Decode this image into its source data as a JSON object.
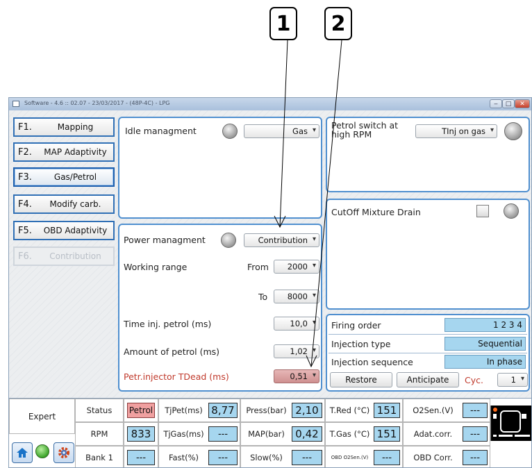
{
  "callouts": [
    "1",
    "2"
  ],
  "window": {
    "title": "Software - 4.6 :: 02.07 - 23/03/2017 - (48P-4C) - LPG",
    "controls": {
      "minimize": "‒",
      "maximize": "□",
      "close": "✕"
    }
  },
  "sidebar": [
    {
      "key": "F1.",
      "label": "Mapping",
      "state": "normal"
    },
    {
      "key": "F2.",
      "label": "MAP Adaptivity",
      "state": "normal"
    },
    {
      "key": "F3.",
      "label": "Gas/Petrol",
      "state": "active"
    },
    {
      "key": "F4.",
      "label": "Modify carb.",
      "state": "normal"
    },
    {
      "key": "F5.",
      "label": "OBD Adaptivity",
      "state": "normal"
    },
    {
      "key": "F6.",
      "label": "Contribution",
      "state": "disabled"
    }
  ],
  "idle": {
    "label": "Idle managment",
    "value": "Gas"
  },
  "power": {
    "label": "Power managment",
    "value": "Contribution",
    "working_range_label": "Working range",
    "from_label": "From",
    "from_value": "2000",
    "to_label": "To",
    "to_value": "8000",
    "time_inj_label": "Time inj. petrol (ms)",
    "time_inj_value": "10,0",
    "amount_label": "Amount of petrol (ms)",
    "amount_value": "1,02",
    "tdead_label": "Petr.injector TDead (ms)",
    "tdead_value": "0,51"
  },
  "petrol_switch": {
    "label": "Petrol switch at high RPM",
    "value": "TInj on gas"
  },
  "cutoff": {
    "label": "CutOff Mixture Drain"
  },
  "injection": {
    "firing_order_label": "Firing order",
    "firing_order_value": "1 2 3 4",
    "injection_type_label": "Injection type",
    "injection_type_value": "Sequential",
    "injection_sequence_label": "Injection sequence",
    "injection_sequence_value": "In phase",
    "restore_label": "Restore",
    "anticipate_label": "Anticipate",
    "cyc_label": "Cyc.",
    "cyc_value": "1"
  },
  "status_bar": {
    "mode": "Expert",
    "row1": {
      "status_label": "Status",
      "status_value": "Petrol",
      "tjpet_label": "TjPet(ms)",
      "tjpet_value": "8,77",
      "press_label": "Press(bar)",
      "press_value": "2,10",
      "tred_label": "T.Red (°C)",
      "tred_value": "151",
      "o2_label": "O2Sen.(V)",
      "o2_value": "---"
    },
    "row2": {
      "rpm_label": "RPM",
      "rpm_value": "833",
      "tjgas_label": "TjGas(ms)",
      "tjgas_value": "---",
      "map_label": "MAP(bar)",
      "map_value": "0,42",
      "tgas_label": "T.Gas (°C)",
      "tgas_value": "151",
      "adat_label": "Adat.corr.",
      "adat_value": "---"
    },
    "row3": {
      "bank_label": "Bank 1",
      "bank_value": "---",
      "fast_label": "Fast(%)",
      "fast_value": "---",
      "slow_label": "Slow(%)",
      "slow_value": "---",
      "obdo2_label": "OBD O2Sen.(V)",
      "obdo2_value": "---",
      "obdcorr_label": "OBD Corr.",
      "obdcorr_value": "---"
    }
  },
  "colors": {
    "accent": "#4f8fcf",
    "value_bg": "#a6d6ef",
    "petrol": "#f0a0a0",
    "red_label": "#c0392b"
  },
  "icons": [
    "home-icon",
    "status-led-icon",
    "settings-gear-icon",
    "fuel-status-icon"
  ]
}
